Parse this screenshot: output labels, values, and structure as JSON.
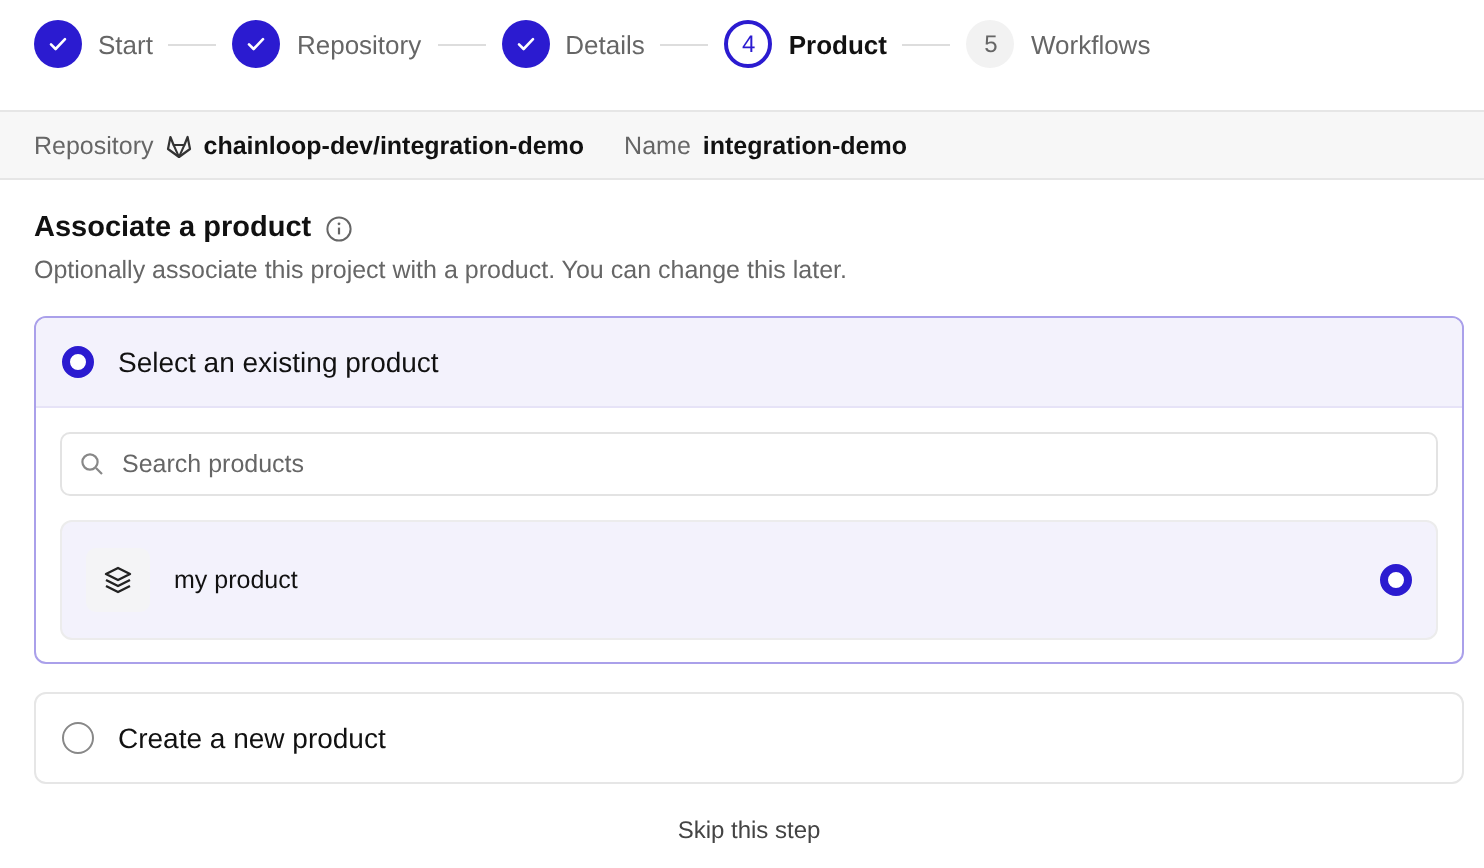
{
  "steps": [
    {
      "label": "Start",
      "kind": "complete"
    },
    {
      "label": "Repository",
      "kind": "complete"
    },
    {
      "label": "Details",
      "kind": "complete"
    },
    {
      "number": "4",
      "label": "Product",
      "kind": "current"
    },
    {
      "number": "5",
      "label": "Workflows",
      "kind": "upcoming"
    }
  ],
  "info_bar": {
    "repository_label": "Repository",
    "repository": "chainloop-dev/integration-demo",
    "name_label": "Name",
    "name": "integration-demo"
  },
  "section": {
    "title": "Associate a product",
    "description": "Optionally associate this project with a product. You can change this later."
  },
  "options": [
    {
      "label": "Select an existing product",
      "selected": true,
      "search": {
        "placeholder": "Search products"
      },
      "products": [
        {
          "name": "my product",
          "selected": true
        }
      ]
    },
    {
      "label": "Create a new product",
      "selected": false
    }
  ],
  "skip_link": "Skip this step"
}
